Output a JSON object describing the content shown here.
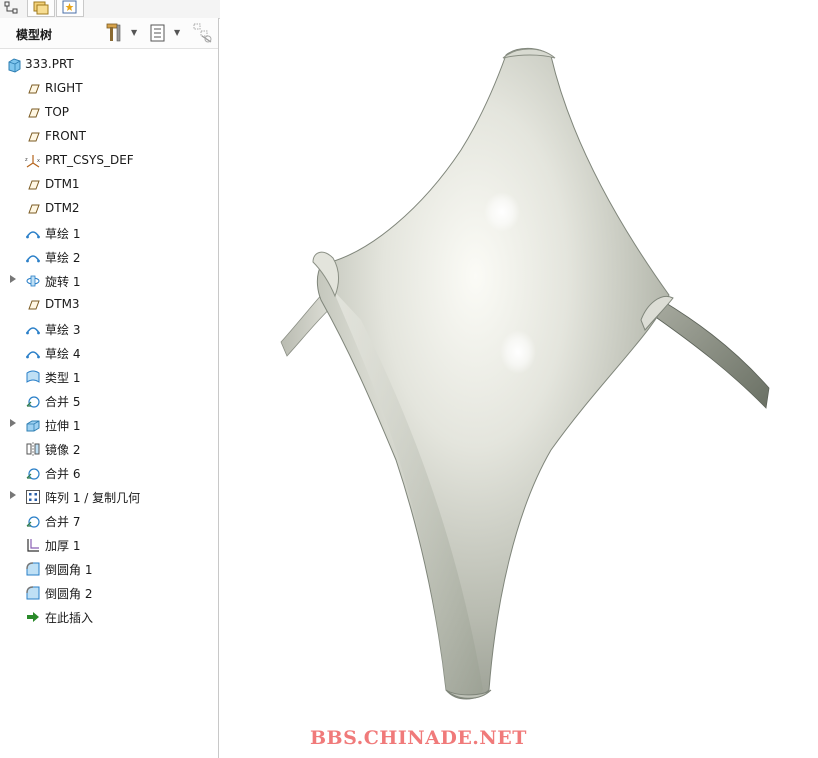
{
  "top_tabs": [
    {
      "name": "model-tree-tab",
      "icon": "tree-icon"
    },
    {
      "name": "folder-browser-tab",
      "icon": "folder-icon"
    },
    {
      "name": "favorites-tab",
      "icon": "star-icon"
    }
  ],
  "panel": {
    "title": "模型树",
    "tools": [
      "settings-icon",
      "show-icon",
      "filter-icon"
    ]
  },
  "tree": {
    "root": {
      "label": "333.PRT",
      "icon": "part-icon"
    },
    "items": [
      {
        "label": "RIGHT",
        "icon": "datum-plane-icon",
        "expandable": false
      },
      {
        "label": "TOP",
        "icon": "datum-plane-icon",
        "expandable": false
      },
      {
        "label": "FRONT",
        "icon": "datum-plane-icon",
        "expandable": false
      },
      {
        "label": "PRT_CSYS_DEF",
        "icon": "csys-icon",
        "expandable": false
      },
      {
        "label": "DTM1",
        "icon": "datum-plane-icon",
        "expandable": false
      },
      {
        "label": "DTM2",
        "icon": "datum-plane-icon",
        "expandable": false
      },
      {
        "label": "草绘 1",
        "icon": "sketch-icon",
        "expandable": false
      },
      {
        "label": "草绘 2",
        "icon": "sketch-icon",
        "expandable": false
      },
      {
        "label": "旋转 1",
        "icon": "revolve-icon",
        "expandable": true
      },
      {
        "label": "DTM3",
        "icon": "datum-plane-icon",
        "expandable": false
      },
      {
        "label": "草绘 3",
        "icon": "sketch-icon",
        "expandable": false
      },
      {
        "label": "草绘 4",
        "icon": "sketch-icon",
        "expandable": false
      },
      {
        "label": "类型 1",
        "icon": "boundary-blend-icon",
        "expandable": false
      },
      {
        "label": "合并 5",
        "icon": "merge-icon",
        "expandable": false
      },
      {
        "label": "拉伸 1",
        "icon": "extrude-icon",
        "expandable": true
      },
      {
        "label": "镜像 2",
        "icon": "mirror-icon",
        "expandable": false
      },
      {
        "label": "合并 6",
        "icon": "merge-icon",
        "expandable": false
      },
      {
        "label": "阵列 1 / 复制几何",
        "icon": "pattern-icon",
        "expandable": true
      },
      {
        "label": "合并 7",
        "icon": "merge-icon",
        "expandable": false
      },
      {
        "label": "加厚 1",
        "icon": "thicken-icon",
        "expandable": false
      },
      {
        "label": "倒圆角 1",
        "icon": "round-icon",
        "expandable": false
      },
      {
        "label": "倒圆角 2",
        "icon": "round-icon",
        "expandable": false
      },
      {
        "label": "在此插入",
        "icon": "insert-here-icon",
        "expandable": false
      }
    ]
  },
  "watermark": "BBS.CHINADE.NET",
  "colors": {
    "model_light": "#f4f4ee",
    "model_mid": "#c9cbc2",
    "model_dark": "#737a6f",
    "watermark": "#f07a7a",
    "insert_arrow": "#2a8a2a"
  }
}
